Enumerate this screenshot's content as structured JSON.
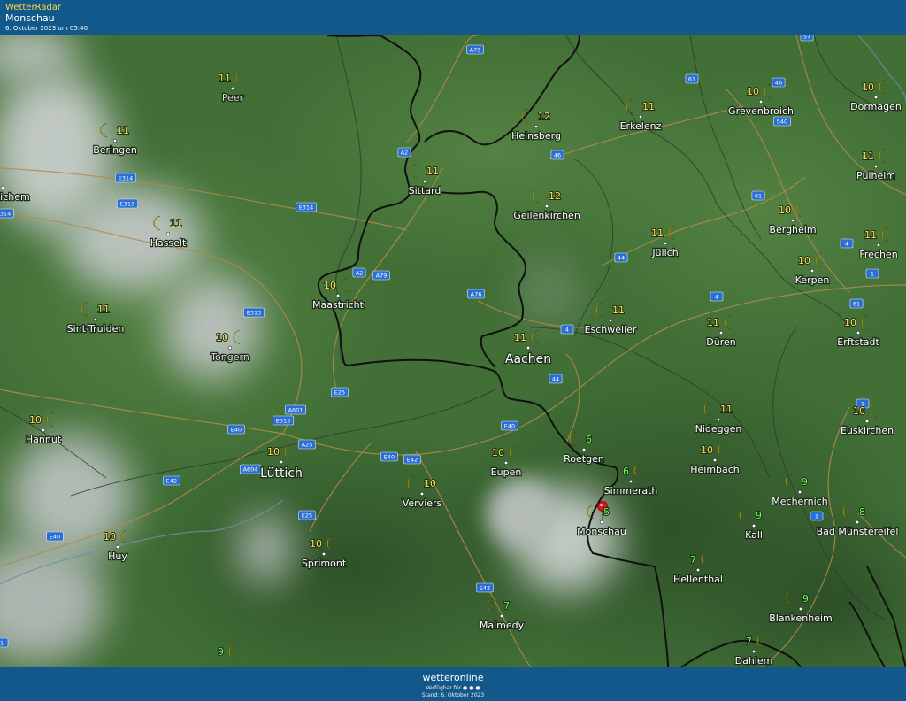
{
  "header": {
    "app_name": "WetterRadar",
    "location": "Monschau",
    "timestamp": "6. Oktober 2023 um 05:40"
  },
  "footer": {
    "brand": "wetteronline",
    "availability": "Verfügbar für",
    "stand": "Stand: 6. Oktober 2023"
  },
  "colors": {
    "header_bg": "#13588a",
    "temp_yellow": "#ffe44a",
    "temp_green": "#6cff52",
    "border": "#111111",
    "road": "#b58a4a",
    "shield": "#2a6fd1"
  },
  "selected_location": "Monschau",
  "cities": [
    {
      "name": "Peer",
      "temp": "11",
      "color": "yellow",
      "faded": true
    },
    {
      "name": "Beringen",
      "temp": "11",
      "color": "yellow"
    },
    {
      "name": "Hasselt",
      "temp": "11",
      "color": "yellow"
    },
    {
      "name": "vel-Zichem",
      "temp": "",
      "color": "yellow"
    },
    {
      "name": "Sint-Truiden",
      "temp": "11",
      "color": "yellow"
    },
    {
      "name": "Tongern",
      "temp": "10",
      "color": "yellow",
      "faded": true
    },
    {
      "name": "Hannut",
      "temp": "10",
      "color": "yellow"
    },
    {
      "name": "Huy",
      "temp": "10",
      "color": "yellow"
    },
    {
      "name": "Lüttich",
      "temp": "10",
      "color": "yellow",
      "big": true
    },
    {
      "name": "Sprimont",
      "temp": "10",
      "color": "yellow"
    },
    {
      "name": "Verviers",
      "temp": "10",
      "color": "yellow"
    },
    {
      "name": "Maastricht",
      "temp": "10",
      "color": "yellow"
    },
    {
      "name": "Sittard",
      "temp": "11",
      "color": "yellow"
    },
    {
      "name": "Heinsberg",
      "temp": "12",
      "color": "yellow"
    },
    {
      "name": "Geilenkirchen",
      "temp": "12",
      "color": "yellow"
    },
    {
      "name": "Erkelenz",
      "temp": "11",
      "color": "yellow"
    },
    {
      "name": "Grevenbroich",
      "temp": "10",
      "color": "yellow"
    },
    {
      "name": "Dormagen",
      "temp": "10",
      "color": "yellow"
    },
    {
      "name": "Pulheim",
      "temp": "11",
      "color": "yellow"
    },
    {
      "name": "Bergheim",
      "temp": "10",
      "color": "yellow"
    },
    {
      "name": "Frechen",
      "temp": "11",
      "color": "yellow"
    },
    {
      "name": "Kerpen",
      "temp": "10",
      "color": "yellow"
    },
    {
      "name": "Erftstadt",
      "temp": "10",
      "color": "yellow"
    },
    {
      "name": "Jülich",
      "temp": "11",
      "color": "yellow"
    },
    {
      "name": "Eschweiler",
      "temp": "11",
      "color": "yellow"
    },
    {
      "name": "Düren",
      "temp": "11",
      "color": "yellow"
    },
    {
      "name": "Aachen",
      "temp": "11",
      "color": "yellow",
      "big": true
    },
    {
      "name": "Nideggen",
      "temp": "11",
      "color": "yellow"
    },
    {
      "name": "Heimbach",
      "temp": "10",
      "color": "yellow"
    },
    {
      "name": "Euskirchen",
      "temp": "10",
      "color": "yellow"
    },
    {
      "name": "Mechernich",
      "temp": "9",
      "color": "green"
    },
    {
      "name": "Bad Münstereifel",
      "temp": "8",
      "color": "green"
    },
    {
      "name": "Kall",
      "temp": "9",
      "color": "green"
    },
    {
      "name": "Hellenthal",
      "temp": "7",
      "color": "green"
    },
    {
      "name": "Blankenheim",
      "temp": "9",
      "color": "green"
    },
    {
      "name": "Dahlem",
      "temp": "7",
      "color": "green"
    },
    {
      "name": "Roetgen",
      "temp": "6",
      "color": "green"
    },
    {
      "name": "Simmerath",
      "temp": "6",
      "color": "green"
    },
    {
      "name": "Monschau",
      "temp": "5",
      "color": "green",
      "selected": true
    },
    {
      "name": "Eupen",
      "temp": "10",
      "color": "yellow"
    },
    {
      "name": "Malmedy",
      "temp": "7",
      "color": "green"
    },
    {
      "name": "",
      "temp": "9",
      "color": "green"
    }
  ],
  "road_shields": [
    "A73",
    "A2",
    "E314",
    "E313",
    "E314",
    "A2",
    "A79",
    "A76",
    "E313",
    "E25",
    "A601",
    "E313",
    "E40",
    "A25",
    "A604",
    "E40",
    "E42",
    "E40",
    "E42",
    "E25",
    "E42",
    "E40",
    "61",
    "46",
    "540",
    "46",
    "61",
    "4",
    "1",
    "61",
    "44",
    "4",
    "4",
    "44",
    "1",
    "1",
    "314",
    "1",
    "57"
  ]
}
